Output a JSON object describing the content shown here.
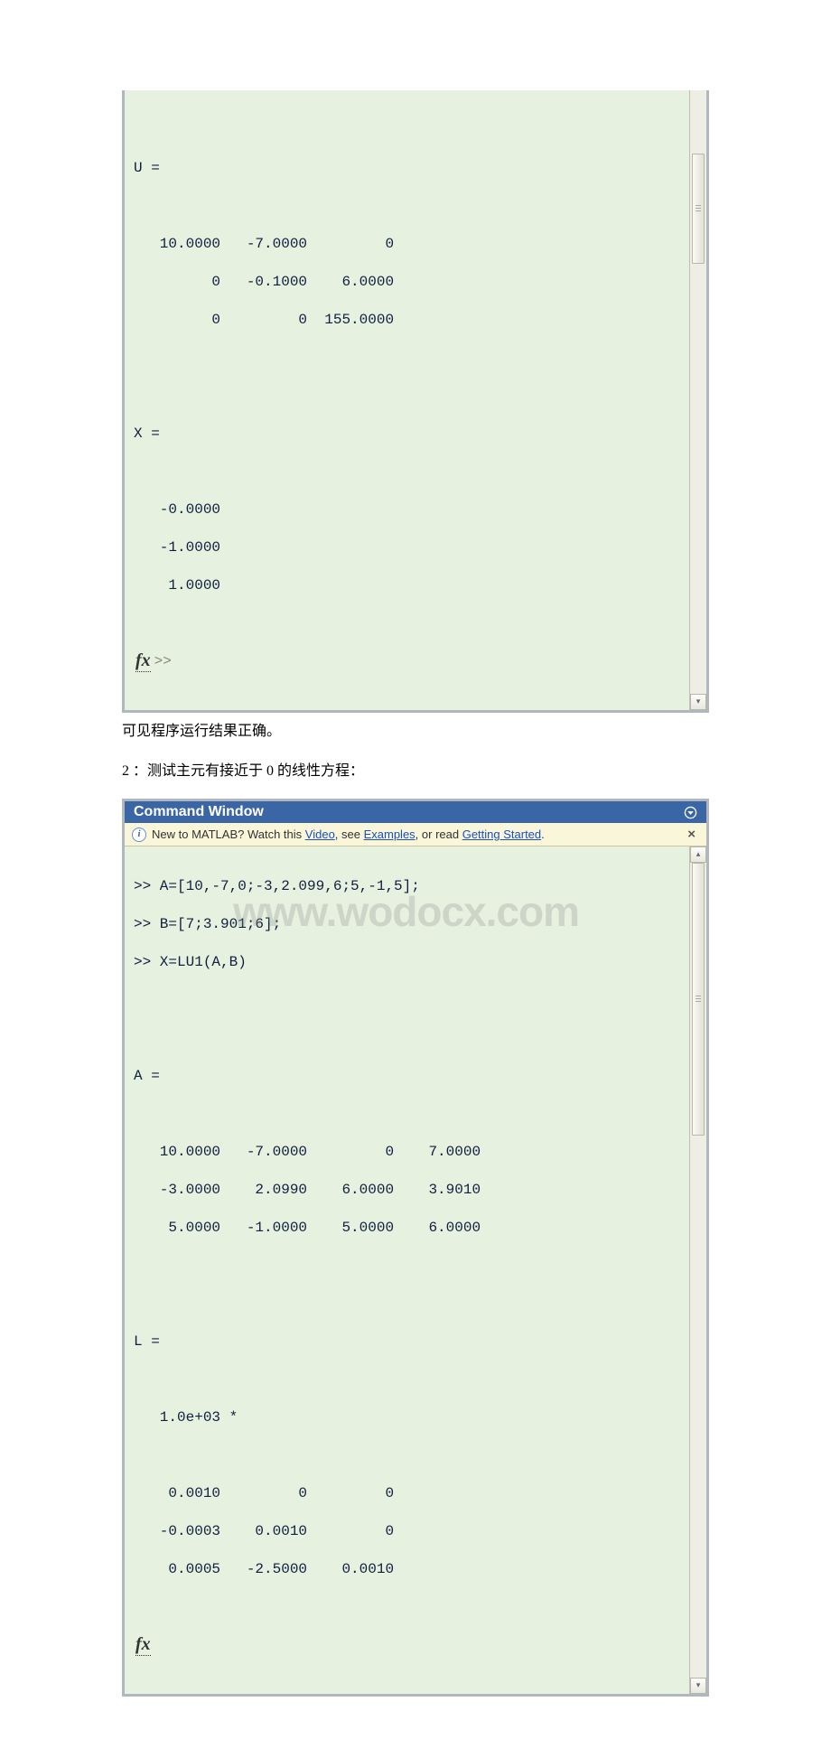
{
  "panel1": {
    "out_U_label": "U =",
    "out_U_rows": [
      "   10.0000   -7.0000         0",
      "         0   -0.1000    6.0000",
      "         0         0  155.0000"
    ],
    "out_X_label": "X =",
    "out_X_rows": [
      "   -0.0000",
      "   -1.0000",
      "    1.0000"
    ],
    "fx_prompt": ">>"
  },
  "text1": "可见程序运行结果正确。",
  "text2": "2 ：测试主元有接近于 0 的线性方程：",
  "panel2": {
    "title": "Command Window",
    "help_prefix": "New to MATLAB? Watch this ",
    "help_video": "Video",
    "help_mid1": ", see ",
    "help_examples": "Examples",
    "help_mid2": ", or read ",
    "help_getting": "Getting Started",
    "help_end": ".",
    "input_lines": [
      ">> A=[10,-7,0;-3,2.099,6;5,-1,5];",
      ">> B=[7;3.901;6];",
      ">> X=LU1(A,B)"
    ],
    "out_A_label": "A =",
    "out_A_rows": [
      "   10.0000   -7.0000         0    7.0000",
      "   -3.0000    2.0990    6.0000    3.9010",
      "    5.0000   -1.0000    5.0000    6.0000"
    ],
    "out_L_label": "L =",
    "out_L_scale": "   1.0e+03 *",
    "out_L_rows": [
      "    0.0010         0         0",
      "   -0.0003    0.0010         0",
      "    0.0005   -2.5000    0.0010"
    ]
  },
  "watermark": "www.wodocx.com"
}
